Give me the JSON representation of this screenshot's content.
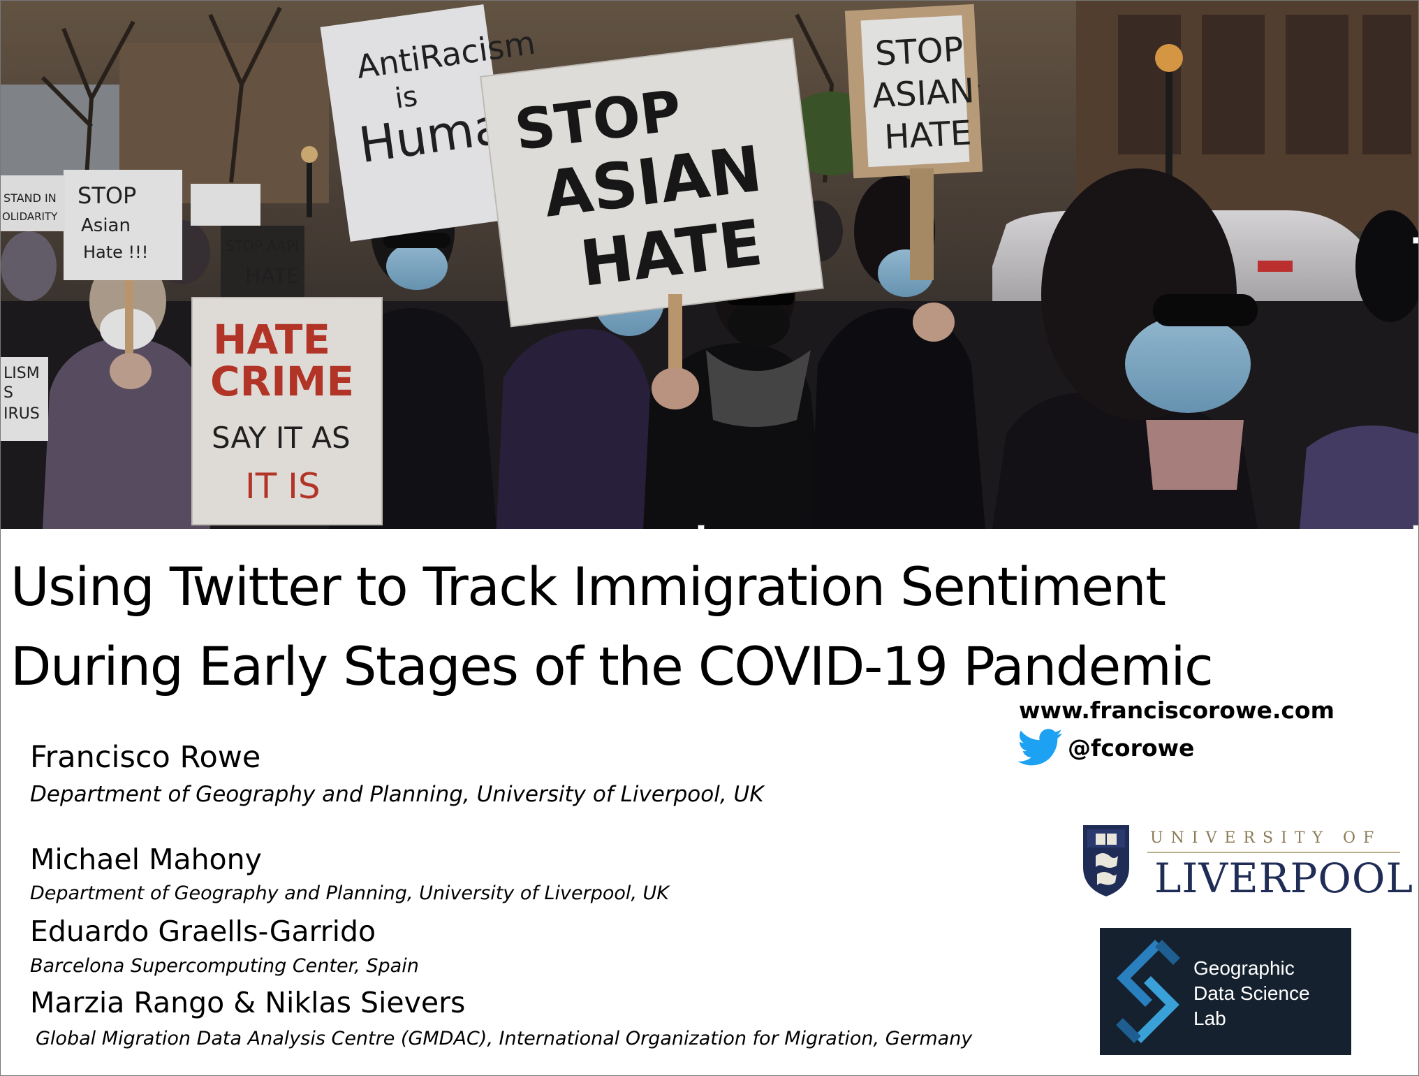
{
  "photo": {
    "alt": "Protesters in face masks holding Stop Asian Hate signs",
    "signs": {
      "stop_asian_hate_center": [
        "STOP",
        "ASIAN",
        "HATE"
      ],
      "stop_asian_hate_right": [
        "STOP",
        "ASIAN",
        "HATE"
      ],
      "anti_racism": [
        "AntiRacism",
        "is",
        "Humani"
      ],
      "stop_asian_hate_left": [
        "STOP",
        "Asian",
        "Hate !!!"
      ],
      "hate_crime": [
        "HATE",
        "CRIME",
        "SAY IT AS",
        "IT IS"
      ],
      "stop_aapi_hate": [
        "STOP AAPI",
        "HATE"
      ],
      "stand_in_solidarity": [
        "STAND IN",
        "OLIDARITY"
      ],
      "racism_virus": [
        "LISM",
        "S",
        "IRUS"
      ]
    }
  },
  "title": {
    "line1": "Using Twitter to Track Immigration Sentiment",
    "line2": "During Early Stages of the COVID-19 Pandemic"
  },
  "authors": [
    {
      "name": "Francisco Rowe",
      "affiliation": "Department of Geography and Planning, University of Liverpool, UK"
    },
    {
      "name": "Michael Mahony",
      "affiliation": "Department of Geography and Planning, University of Liverpool, UK"
    },
    {
      "name": "Eduardo Graells-Garrido",
      "affiliation": "Barcelona Supercomputing Center, Spain"
    },
    {
      "name": "Marzia Rango & Niklas Sievers",
      "affiliation": "Global Migration Data Analysis Centre (GMDAC), International Organization for Migration, Germany"
    }
  ],
  "contact": {
    "website": "www.franciscorowe.com",
    "twitter": "@fcorowe"
  },
  "logos": {
    "university_top": "UNIVERSITY OF",
    "university_main": "LIVERPOOL",
    "lab_lines": [
      "Geographic",
      "Data Science",
      "Lab"
    ]
  },
  "colors": {
    "university_navy": "#1f2c56",
    "university_gold": "#8a7a55",
    "lab_background": "#15212e",
    "twitter_blue": "#1da1f2"
  }
}
